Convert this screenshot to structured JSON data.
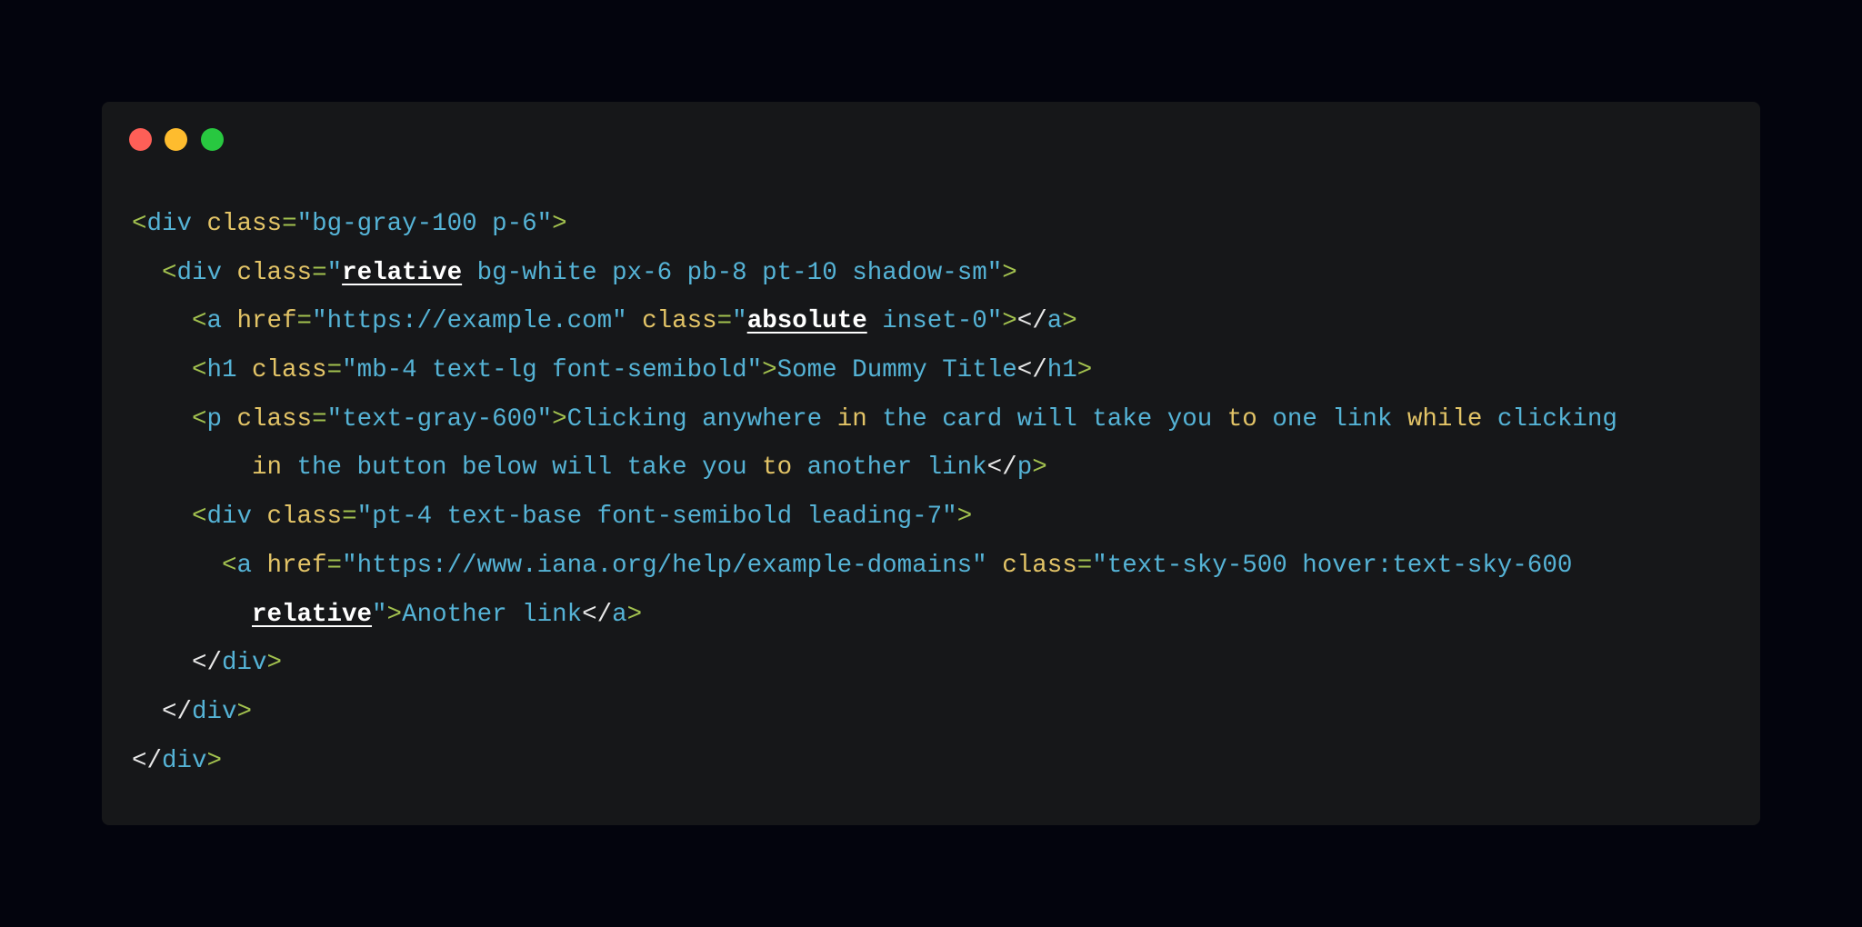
{
  "window": {
    "controls": [
      {
        "name": "close-button",
        "color": "#fe5f57"
      },
      {
        "name": "minimize-button",
        "color": "#febc2e"
      },
      {
        "name": "maximize-button",
        "color": "#28c840"
      }
    ]
  },
  "colors": {
    "background": "#03040d",
    "card": "#161719",
    "punct": "#a3c24f",
    "attr": "#e3c467",
    "string": "#55b3d6",
    "highlight": "#ffffff"
  },
  "code": {
    "lines": [
      {
        "indent": 0,
        "tokens": [
          [
            "g",
            "<"
          ],
          [
            "b",
            "div"
          ],
          [
            "y",
            " class"
          ],
          [
            "g",
            "="
          ],
          [
            "b",
            "\"bg-gray-100 p-6\""
          ],
          [
            "g",
            ">"
          ]
        ]
      },
      {
        "indent": 2,
        "tokens": [
          [
            "g",
            "<"
          ],
          [
            "b",
            "div"
          ],
          [
            "y",
            " class"
          ],
          [
            "g",
            "="
          ],
          [
            "b",
            "\""
          ],
          [
            "w",
            "relative"
          ],
          [
            "b",
            " bg-white px-6 pb-8 pt-10 shadow-sm\""
          ],
          [
            "g",
            ">"
          ]
        ]
      },
      {
        "indent": 4,
        "tokens": [
          [
            "g",
            "<"
          ],
          [
            "b",
            "a"
          ],
          [
            "y",
            " href"
          ],
          [
            "g",
            "="
          ],
          [
            "b",
            "\"https://example.com\""
          ],
          [
            "y",
            " class"
          ],
          [
            "g",
            "="
          ],
          [
            "b",
            "\""
          ],
          [
            "w",
            "absolute"
          ],
          [
            "b",
            " inset-0\""
          ],
          [
            "g",
            ">"
          ],
          [
            "s",
            "</"
          ],
          [
            "b",
            "a"
          ],
          [
            "g",
            ">"
          ]
        ]
      },
      {
        "indent": 4,
        "tokens": [
          [
            "g",
            "<"
          ],
          [
            "b",
            "h1"
          ],
          [
            "y",
            " class"
          ],
          [
            "g",
            "="
          ],
          [
            "b",
            "\"mb-4 text-lg font-semibold\""
          ],
          [
            "g",
            ">"
          ],
          [
            "b",
            "Some Dummy Title"
          ],
          [
            "s",
            "</"
          ],
          [
            "b",
            "h1"
          ],
          [
            "g",
            ">"
          ]
        ]
      },
      {
        "indent": 4,
        "tokens": [
          [
            "g",
            "<"
          ],
          [
            "b",
            "p"
          ],
          [
            "y",
            " class"
          ],
          [
            "g",
            "="
          ],
          [
            "b",
            "\"text-gray-600\""
          ],
          [
            "g",
            ">"
          ],
          [
            "b",
            "Clicking anywhere "
          ],
          [
            "y",
            "in"
          ],
          [
            "b",
            " the card will take you "
          ],
          [
            "y",
            "to"
          ],
          [
            "b",
            " one link "
          ],
          [
            "y",
            "while"
          ],
          [
            "b",
            " clicking"
          ]
        ]
      },
      {
        "indent": 8,
        "tokens": [
          [
            "y",
            "in"
          ],
          [
            "b",
            " the button below will take you "
          ],
          [
            "y",
            "to"
          ],
          [
            "b",
            " another link"
          ],
          [
            "s",
            "</"
          ],
          [
            "b",
            "p"
          ],
          [
            "g",
            ">"
          ]
        ]
      },
      {
        "indent": 4,
        "tokens": [
          [
            "g",
            "<"
          ],
          [
            "b",
            "div"
          ],
          [
            "y",
            " class"
          ],
          [
            "g",
            "="
          ],
          [
            "b",
            "\"pt-4 text-base font-semibold leading-7\""
          ],
          [
            "g",
            ">"
          ]
        ]
      },
      {
        "indent": 6,
        "tokens": [
          [
            "g",
            "<"
          ],
          [
            "b",
            "a"
          ],
          [
            "y",
            " href"
          ],
          [
            "g",
            "="
          ],
          [
            "b",
            "\"https://www.iana.org/help/example-domains\""
          ],
          [
            "y",
            " class"
          ],
          [
            "g",
            "="
          ],
          [
            "b",
            "\"text-sky-500 hover:text-sky-600"
          ]
        ]
      },
      {
        "indent": 8,
        "tokens": [
          [
            "w",
            "relative"
          ],
          [
            "b",
            "\""
          ],
          [
            "g",
            ">"
          ],
          [
            "b",
            "Another link"
          ],
          [
            "s",
            "</"
          ],
          [
            "b",
            "a"
          ],
          [
            "g",
            ">"
          ]
        ]
      },
      {
        "indent": 4,
        "tokens": [
          [
            "s",
            "</"
          ],
          [
            "b",
            "div"
          ],
          [
            "g",
            ">"
          ]
        ]
      },
      {
        "indent": 2,
        "tokens": [
          [
            "s",
            "</"
          ],
          [
            "b",
            "div"
          ],
          [
            "g",
            ">"
          ]
        ]
      },
      {
        "indent": 0,
        "tokens": [
          [
            "s",
            "</"
          ],
          [
            "b",
            "div"
          ],
          [
            "g",
            ">"
          ]
        ]
      }
    ]
  }
}
